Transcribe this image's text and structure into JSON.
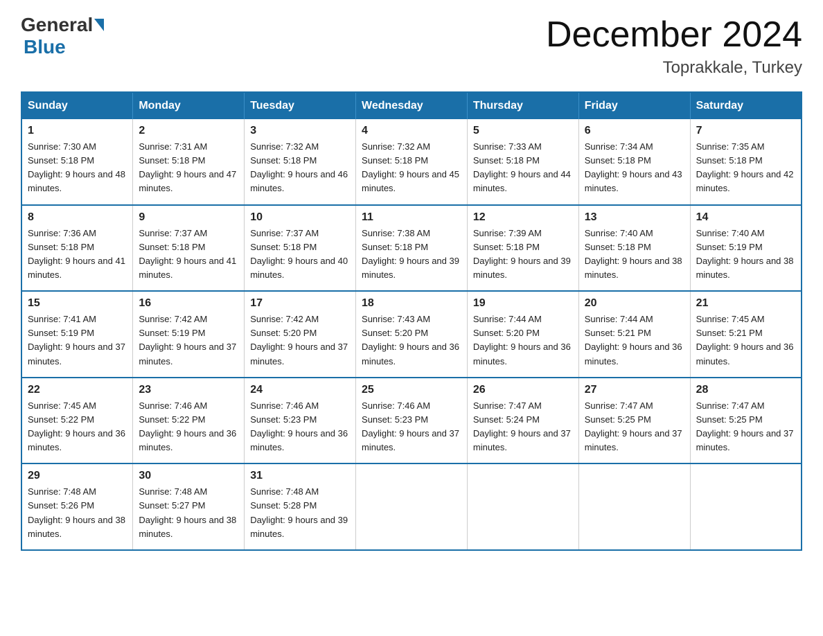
{
  "logo": {
    "general": "General",
    "blue": "Blue"
  },
  "title": "December 2024",
  "subtitle": "Toprakkale, Turkey",
  "weekdays": [
    "Sunday",
    "Monday",
    "Tuesday",
    "Wednesday",
    "Thursday",
    "Friday",
    "Saturday"
  ],
  "weeks": [
    [
      {
        "day": "1",
        "sunrise": "7:30 AM",
        "sunset": "5:18 PM",
        "daylight": "9 hours and 48 minutes."
      },
      {
        "day": "2",
        "sunrise": "7:31 AM",
        "sunset": "5:18 PM",
        "daylight": "9 hours and 47 minutes."
      },
      {
        "day": "3",
        "sunrise": "7:32 AM",
        "sunset": "5:18 PM",
        "daylight": "9 hours and 46 minutes."
      },
      {
        "day": "4",
        "sunrise": "7:32 AM",
        "sunset": "5:18 PM",
        "daylight": "9 hours and 45 minutes."
      },
      {
        "day": "5",
        "sunrise": "7:33 AM",
        "sunset": "5:18 PM",
        "daylight": "9 hours and 44 minutes."
      },
      {
        "day": "6",
        "sunrise": "7:34 AM",
        "sunset": "5:18 PM",
        "daylight": "9 hours and 43 minutes."
      },
      {
        "day": "7",
        "sunrise": "7:35 AM",
        "sunset": "5:18 PM",
        "daylight": "9 hours and 42 minutes."
      }
    ],
    [
      {
        "day": "8",
        "sunrise": "7:36 AM",
        "sunset": "5:18 PM",
        "daylight": "9 hours and 41 minutes."
      },
      {
        "day": "9",
        "sunrise": "7:37 AM",
        "sunset": "5:18 PM",
        "daylight": "9 hours and 41 minutes."
      },
      {
        "day": "10",
        "sunrise": "7:37 AM",
        "sunset": "5:18 PM",
        "daylight": "9 hours and 40 minutes."
      },
      {
        "day": "11",
        "sunrise": "7:38 AM",
        "sunset": "5:18 PM",
        "daylight": "9 hours and 39 minutes."
      },
      {
        "day": "12",
        "sunrise": "7:39 AM",
        "sunset": "5:18 PM",
        "daylight": "9 hours and 39 minutes."
      },
      {
        "day": "13",
        "sunrise": "7:40 AM",
        "sunset": "5:18 PM",
        "daylight": "9 hours and 38 minutes."
      },
      {
        "day": "14",
        "sunrise": "7:40 AM",
        "sunset": "5:19 PM",
        "daylight": "9 hours and 38 minutes."
      }
    ],
    [
      {
        "day": "15",
        "sunrise": "7:41 AM",
        "sunset": "5:19 PM",
        "daylight": "9 hours and 37 minutes."
      },
      {
        "day": "16",
        "sunrise": "7:42 AM",
        "sunset": "5:19 PM",
        "daylight": "9 hours and 37 minutes."
      },
      {
        "day": "17",
        "sunrise": "7:42 AM",
        "sunset": "5:20 PM",
        "daylight": "9 hours and 37 minutes."
      },
      {
        "day": "18",
        "sunrise": "7:43 AM",
        "sunset": "5:20 PM",
        "daylight": "9 hours and 36 minutes."
      },
      {
        "day": "19",
        "sunrise": "7:44 AM",
        "sunset": "5:20 PM",
        "daylight": "9 hours and 36 minutes."
      },
      {
        "day": "20",
        "sunrise": "7:44 AM",
        "sunset": "5:21 PM",
        "daylight": "9 hours and 36 minutes."
      },
      {
        "day": "21",
        "sunrise": "7:45 AM",
        "sunset": "5:21 PM",
        "daylight": "9 hours and 36 minutes."
      }
    ],
    [
      {
        "day": "22",
        "sunrise": "7:45 AM",
        "sunset": "5:22 PM",
        "daylight": "9 hours and 36 minutes."
      },
      {
        "day": "23",
        "sunrise": "7:46 AM",
        "sunset": "5:22 PM",
        "daylight": "9 hours and 36 minutes."
      },
      {
        "day": "24",
        "sunrise": "7:46 AM",
        "sunset": "5:23 PM",
        "daylight": "9 hours and 36 minutes."
      },
      {
        "day": "25",
        "sunrise": "7:46 AM",
        "sunset": "5:23 PM",
        "daylight": "9 hours and 37 minutes."
      },
      {
        "day": "26",
        "sunrise": "7:47 AM",
        "sunset": "5:24 PM",
        "daylight": "9 hours and 37 minutes."
      },
      {
        "day": "27",
        "sunrise": "7:47 AM",
        "sunset": "5:25 PM",
        "daylight": "9 hours and 37 minutes."
      },
      {
        "day": "28",
        "sunrise": "7:47 AM",
        "sunset": "5:25 PM",
        "daylight": "9 hours and 37 minutes."
      }
    ],
    [
      {
        "day": "29",
        "sunrise": "7:48 AM",
        "sunset": "5:26 PM",
        "daylight": "9 hours and 38 minutes."
      },
      {
        "day": "30",
        "sunrise": "7:48 AM",
        "sunset": "5:27 PM",
        "daylight": "9 hours and 38 minutes."
      },
      {
        "day": "31",
        "sunrise": "7:48 AM",
        "sunset": "5:28 PM",
        "daylight": "9 hours and 39 minutes."
      },
      null,
      null,
      null,
      null
    ]
  ]
}
